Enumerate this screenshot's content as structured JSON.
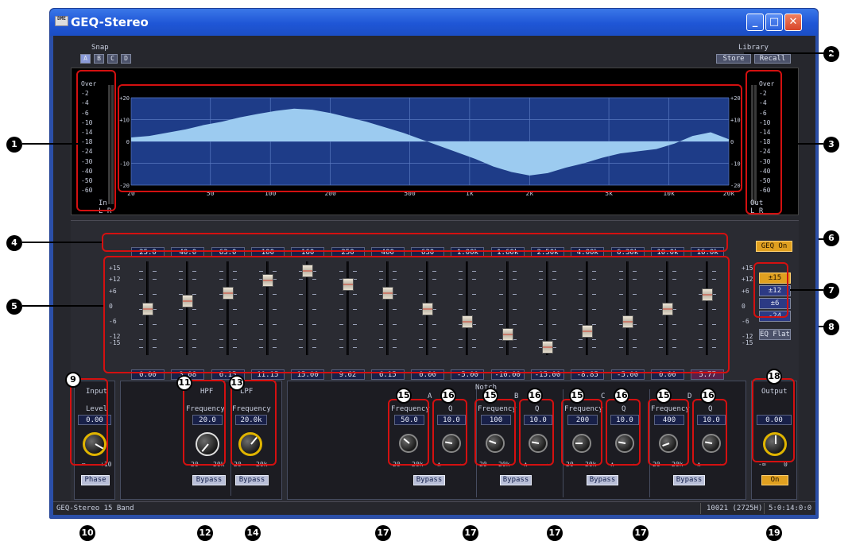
{
  "window": {
    "title": "GEQ-Stereo",
    "app_icon_text": "DME",
    "minimize": "_",
    "maximize": "□",
    "close": "✕"
  },
  "snap": {
    "label": "Snap",
    "buttons": [
      "A",
      "B",
      "C",
      "D"
    ]
  },
  "library": {
    "label": "Library",
    "store": "Store",
    "recall": "Recall"
  },
  "meter_in": {
    "scale": [
      "Over",
      "-2",
      "-4",
      "-6",
      "-10",
      "-14",
      "-18",
      "-24",
      "-30",
      "-40",
      "-50",
      "-60"
    ],
    "label": "In",
    "channels": "L R"
  },
  "meter_out": {
    "scale": [
      "Over",
      "-2",
      "-4",
      "-6",
      "-10",
      "-14",
      "-18",
      "-24",
      "-30",
      "-40",
      "-50",
      "-60"
    ],
    "label": "Out",
    "channels": "L R"
  },
  "graph": {
    "y_labels": [
      "+20",
      "+10",
      "0",
      "-10",
      "-20"
    ],
    "x_labels": [
      "20",
      "50",
      "100",
      "200",
      "500",
      "1k",
      "2k",
      "5k",
      "10k",
      "20k"
    ],
    "fill_color": "#9ccbf0",
    "curve_db": [
      1.8,
      2.5,
      4,
      5.5,
      7.5,
      9,
      11,
      12.6,
      14,
      15,
      14.5,
      13,
      11,
      9,
      6.5,
      4,
      1,
      -2,
      -5,
      -8,
      -11.5,
      -14,
      -15.6,
      -14.5,
      -12,
      -10,
      -7.5,
      -5.5,
      -4.5,
      -3.5,
      -1,
      2.5,
      4.2,
      1
    ]
  },
  "bands": [
    "25.0",
    "40.0",
    "63.0",
    "100",
    "160",
    "250",
    "400",
    "630",
    "1.00k",
    "1.60k",
    "2.50k",
    "4.00k",
    "6.30k",
    "10.0k",
    "16.0k"
  ],
  "gains": [
    "0.00",
    "3.08",
    "6.15",
    "11.15",
    "15.00",
    "9.62",
    "6.15",
    "0.00",
    "-5.00",
    "-10.00",
    "-15.00",
    "-8.85",
    "-5.00",
    "0.00",
    "5.77"
  ],
  "gain_db": [
    0,
    3.08,
    6.15,
    11.15,
    15,
    9.62,
    6.15,
    0,
    -5,
    -10,
    -15,
    -8.85,
    -5,
    0,
    5.77
  ],
  "fader_scale": [
    "+15",
    "+12",
    "+6",
    "0",
    "-6",
    "-12",
    "-15"
  ],
  "geq_button": "GEQ On",
  "range_buttons": [
    "±15",
    "±12",
    "±6",
    "-24"
  ],
  "range_selected": "±15",
  "eq_flat": "EQ Flat",
  "input": {
    "label": "Input",
    "level_label": "Level",
    "level_value": "0.00",
    "min": "-∞",
    "max": "+10",
    "phase": "Phase"
  },
  "hpf": {
    "label": "HPF",
    "freq_label": "Frequency",
    "freq_value": "20.0",
    "min": "20",
    "max": "20k",
    "bypass": "Bypass"
  },
  "lpf": {
    "label": "LPF",
    "freq_label": "Frequency",
    "freq_value": "20.0k",
    "min": "20",
    "max": "20k",
    "bypass": "Bypass"
  },
  "notch": {
    "label": "Notch",
    "filters": [
      {
        "id": "A",
        "freq_label": "Frequency",
        "freq_value": "50.0",
        "q_label": "Q",
        "q_value": "10.0",
        "min": "20",
        "max": "20k",
        "bypass": "Bypass"
      },
      {
        "id": "B",
        "freq_label": "Frequency",
        "freq_value": "100",
        "q_label": "Q",
        "q_value": "10.0",
        "min": "20",
        "max": "20k",
        "bypass": "Bypass"
      },
      {
        "id": "C",
        "freq_label": "Frequency",
        "freq_value": "200",
        "q_label": "Q",
        "q_value": "10.0",
        "min": "20",
        "max": "20k",
        "bypass": "Bypass"
      },
      {
        "id": "D",
        "freq_label": "Frequency",
        "freq_value": "400",
        "q_label": "Q",
        "q_value": "10.0",
        "min": "20",
        "max": "20k",
        "bypass": "Bypass"
      }
    ]
  },
  "output": {
    "label": "Output",
    "level_value": "0.00",
    "min": "-∞",
    "max": "0",
    "on": "On"
  },
  "status": {
    "left": "GEQ-Stereo    15 Band",
    "mid": "10021 (2725H)",
    "right": "5:0:14:0:0"
  },
  "callouts": [
    "1",
    "2",
    "3",
    "4",
    "5",
    "6",
    "7",
    "8",
    "9",
    "10",
    "11",
    "12",
    "13",
    "14",
    "15",
    "16",
    "17",
    "18",
    "19"
  ]
}
